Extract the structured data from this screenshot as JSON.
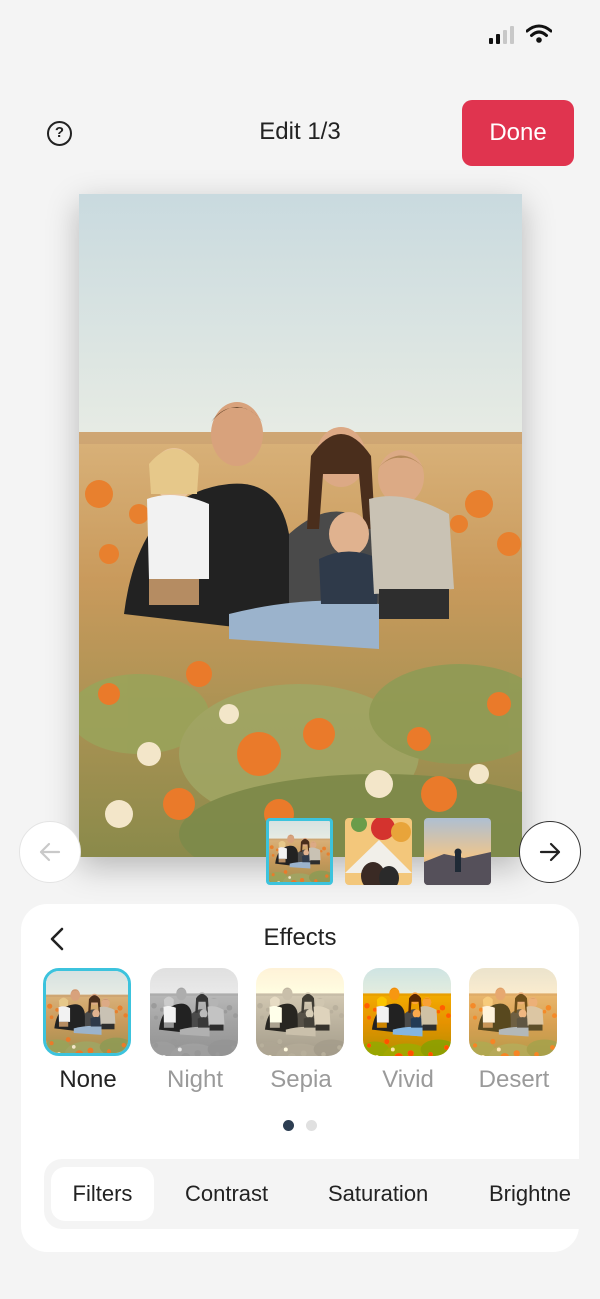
{
  "header": {
    "title": "Edit 1/3",
    "done_label": "Done",
    "help_glyph": "?"
  },
  "icons": {
    "help": "help-circle-icon",
    "prev": "arrow-left-icon",
    "next": "arrow-right-icon",
    "back": "chevron-left-icon"
  },
  "colors": {
    "accent": "#e0344f",
    "selection": "#3cc3dd",
    "dot_active": "#2d3e52"
  },
  "effects_panel": {
    "title": "Effects",
    "effects": [
      {
        "label": "None"
      },
      {
        "label": "Night"
      },
      {
        "label": "Sepia"
      },
      {
        "label": "Vivid"
      },
      {
        "label": "Desert"
      }
    ],
    "selected_effect": "None",
    "page": 1,
    "page_count": 2,
    "tabs": [
      {
        "label": "Filters"
      },
      {
        "label": "Contrast"
      },
      {
        "label": "Saturation"
      },
      {
        "label": "Brightne"
      }
    ],
    "selected_tab": "Filters"
  }
}
